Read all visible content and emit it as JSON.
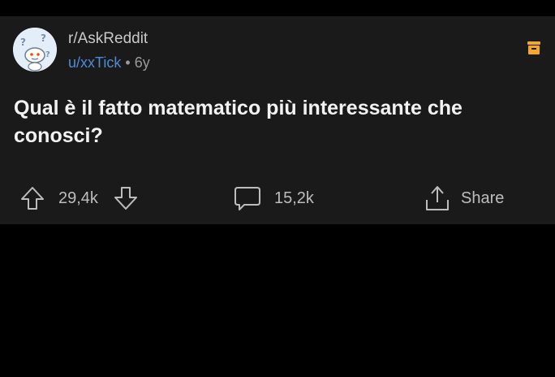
{
  "post": {
    "subreddit": "r/AskReddit",
    "username": "u/xxTick",
    "separator": "•",
    "age": "6y",
    "title": "Qual è il fatto matematico più interessante che conosci?"
  },
  "actions": {
    "upvote_icon": "arrow-up-icon",
    "downvote_icon": "arrow-down-icon",
    "vote_count": "29,4k",
    "comment_icon": "comment-bubble-icon",
    "comment_count": "15,2k",
    "share_icon": "share-icon",
    "share_label": "Share"
  },
  "icons": {
    "archive": "archive-box-icon",
    "avatar": "askreddit-snoo-avatar"
  },
  "colors": {
    "background": "#000000",
    "card": "#1a1a1b",
    "username": "#4f8ad6",
    "archive": "#f5a623"
  }
}
